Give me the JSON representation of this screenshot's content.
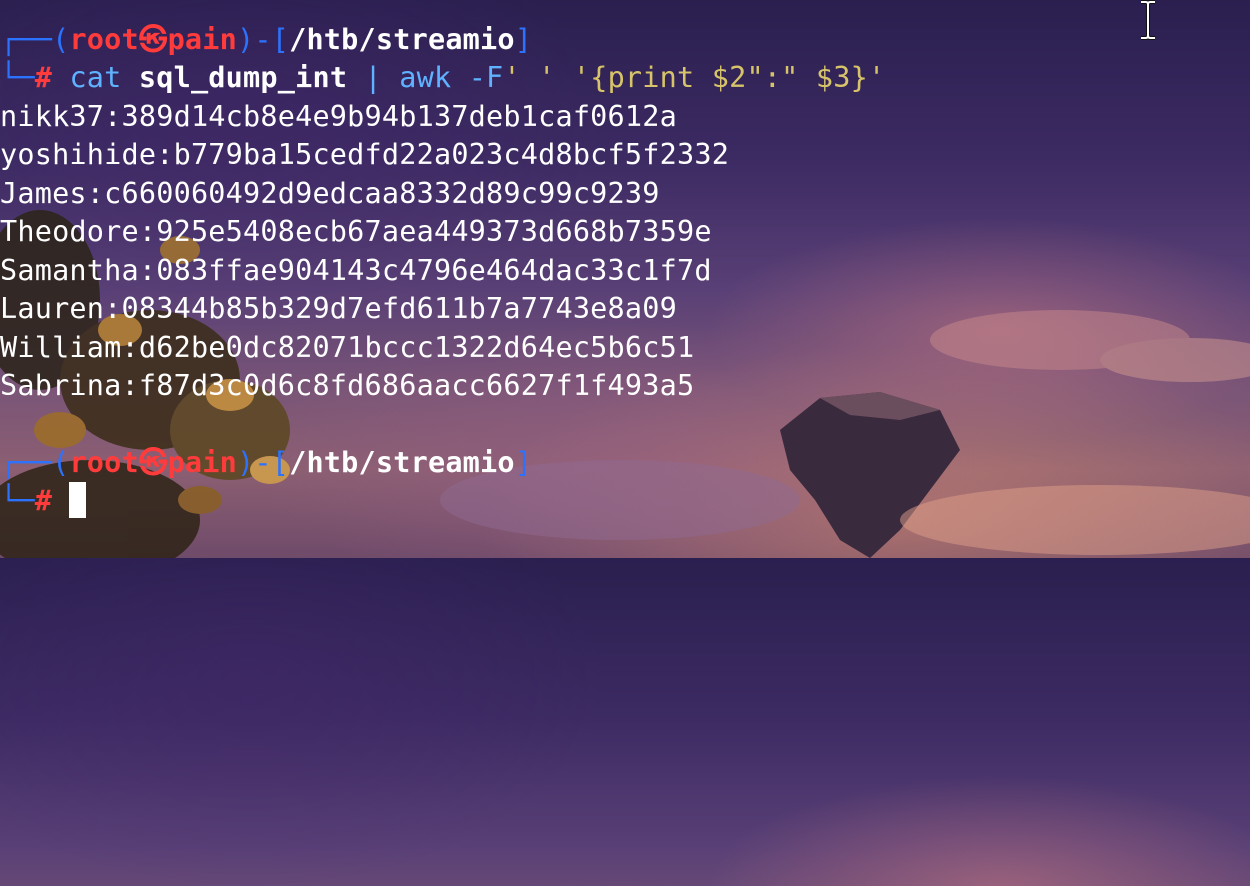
{
  "prompt1": {
    "frame_open": "┌──(",
    "user": "root",
    "at_symbol": "㉿",
    "host": "pain",
    "frame_mid": ")-[",
    "path": "/htb/streamio",
    "frame_close": "]",
    "frame_corner": "└─",
    "hash": "#"
  },
  "command": {
    "cmd": "cat",
    "arg": "sql_dump_int",
    "pipe": "|",
    "awk": "awk",
    "flag": "-F",
    "sep": "' '",
    "program_open": "'{",
    "print": "print",
    "field2": "$2",
    "colon": "\":\"",
    "field3": "$3",
    "program_close": "}'"
  },
  "output": [
    "nikk37:389d14cb8e4e9b94b137deb1caf0612a",
    "yoshihide:b779ba15cedfd22a023c4d8bcf5f2332",
    "James:c660060492d9edcaa8332d89c99c9239",
    "Theodore:925e5408ecb67aea449373d668b7359e",
    "Samantha:083ffae904143c4796e464dac33c1f7d",
    "Lauren:08344b85b329d7efd611b7a7743e8a09",
    "William:d62be0dc82071bccc1322d64ec5b6c51",
    "Sabrina:f87d3c0d6c8fd686aacc6627f1f493a5"
  ],
  "prompt2": {
    "frame_open": "┌──(",
    "user": "root",
    "at_symbol": "㉿",
    "host": "pain",
    "frame_mid": ")-[",
    "path": "/htb/streamio",
    "frame_close": "]",
    "frame_corner": "└─",
    "hash": "#"
  },
  "colors": {
    "frame": "#2b73ff",
    "user": "#ff3b3b",
    "command": "#5fb2ff",
    "string": "#d7c46a",
    "text": "#ffffff"
  },
  "icons": {
    "text_cursor": "i-beam-cursor-icon",
    "terminal_cursor": "block-cursor"
  }
}
